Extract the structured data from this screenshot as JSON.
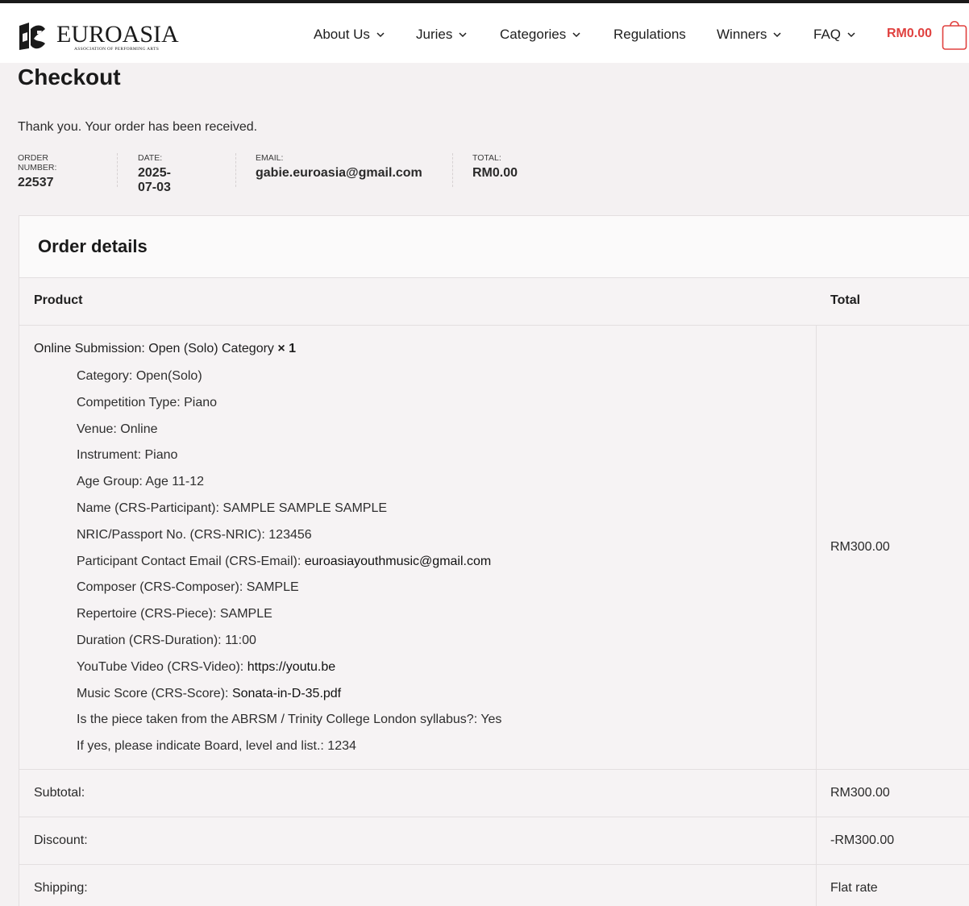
{
  "header": {
    "logo": {
      "word": "EUROASIA",
      "sub": "ASSOCIATION OF PERFORMING ARTS"
    },
    "nav": [
      {
        "label": "About Us",
        "dropdown": true
      },
      {
        "label": "Juries",
        "dropdown": true
      },
      {
        "label": "Categories",
        "dropdown": true
      },
      {
        "label": "Regulations",
        "dropdown": false
      },
      {
        "label": "Winners",
        "dropdown": true
      },
      {
        "label": "FAQ",
        "dropdown": true
      }
    ],
    "cart_total": "RM0.00"
  },
  "page": {
    "title": "Checkout",
    "thanks": "Thank you. Your order has been received."
  },
  "overview": [
    {
      "label": "ORDER NUMBER:",
      "value": "22537"
    },
    {
      "label": "DATE:",
      "value": "2025-07-03"
    },
    {
      "label": "EMAIL:",
      "value": "gabie.euroasia@gmail.com"
    },
    {
      "label": "TOTAL:",
      "value": "RM0.00"
    }
  ],
  "order_details": {
    "title": "Order details",
    "columns": {
      "product": "Product",
      "total": "Total"
    },
    "item": {
      "name": "Online Submission: Open (Solo) Category",
      "qty": "× 1",
      "total": "RM300.00",
      "meta": [
        {
          "key": "Category:",
          "value": "Open(Solo)"
        },
        {
          "key": "Competition Type:",
          "value": "Piano"
        },
        {
          "key": "Venue:",
          "value": "Online"
        },
        {
          "key": "Instrument:",
          "value": "Piano"
        },
        {
          "key": "Age Group:",
          "value": "Age 11-12"
        },
        {
          "key": "Name (CRS-Participant):",
          "value": "SAMPLE SAMPLE SAMPLE"
        },
        {
          "key": "NRIC/Passport No. (CRS-NRIC):",
          "value": "123456"
        },
        {
          "key": "Participant Contact Email (CRS-Email):",
          "value": "euroasiayouthmusic@gmail.com"
        },
        {
          "key": "Composer (CRS-Composer):",
          "value": "SAMPLE"
        },
        {
          "key": "Repertoire (CRS-Piece):",
          "value": "SAMPLE"
        },
        {
          "key": "Duration (CRS-Duration):",
          "value": "11:00"
        },
        {
          "key": "YouTube Video (CRS-Video):",
          "value": "https://youtu.be"
        },
        {
          "key": "Music Score (CRS-Score):",
          "value": "Sonata-in-D-35.pdf"
        },
        {
          "key": "Is the piece taken from the ABRSM / Trinity College London syllabus?:",
          "value": "Yes"
        },
        {
          "key": "If yes, please indicate Board, level and list.:",
          "value": "1234"
        }
      ]
    },
    "totals": [
      {
        "label": "Subtotal:",
        "value": "RM300.00"
      },
      {
        "label": "Discount:",
        "value": "-RM300.00"
      },
      {
        "label": "Shipping:",
        "value": "Flat rate"
      }
    ]
  },
  "colors": {
    "accent": "#e0413f",
    "background": "#f4f1f2",
    "header": "#ffffff"
  }
}
